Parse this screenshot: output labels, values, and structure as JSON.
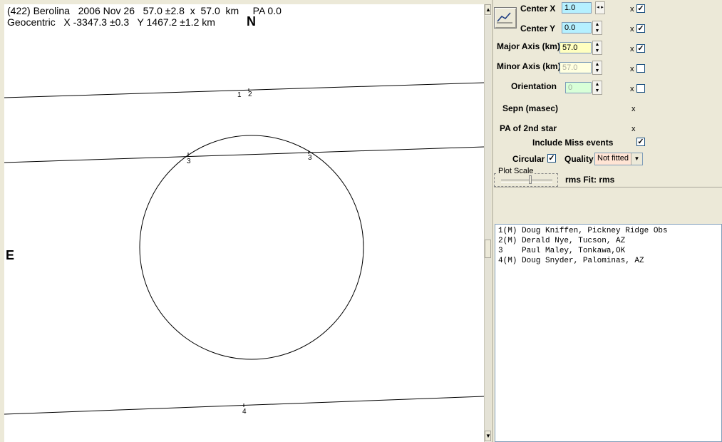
{
  "plot": {
    "header_line1": "(422) Berolina   2006 Nov 26   57.0 ±2.8  x  57.0  km     PA 0.0",
    "header_line2": "Geocentric   X -3347.3 ±0.3   Y 1467.2 ±1.2 km",
    "north_label": "N",
    "east_label": "E",
    "chord_labels": [
      "1",
      "2",
      "3",
      "3",
      "4"
    ]
  },
  "controls": {
    "center_x": {
      "label": "Center X",
      "value": "1.0",
      "x_mark": "x",
      "checked": true,
      "color": "#b5f0ff"
    },
    "center_y": {
      "label": "Center Y",
      "value": "0.0",
      "x_mark": "x",
      "checked": true,
      "color": "#b5f0ff"
    },
    "major_axis": {
      "label": "Major Axis (km)",
      "value": "57.0",
      "x_mark": "x",
      "checked": true,
      "color": "#ffffc0"
    },
    "minor_axis": {
      "label": "Minor Axis (km)",
      "value": "57.0",
      "x_mark": "x",
      "checked": false,
      "color": "#ffffe0"
    },
    "orientation": {
      "label": "Orientation",
      "value": "0",
      "x_mark": "x",
      "checked": false,
      "color": "#d8ffd8"
    },
    "sepn": {
      "label": "Sepn (masec)",
      "x_mark": "x"
    },
    "pa_2nd_star": {
      "label": "PA of 2nd star",
      "x_mark": "x"
    },
    "include_miss": {
      "label": "Include Miss events",
      "checked": true
    },
    "circular": {
      "label": "Circular",
      "checked": true
    },
    "quality": {
      "label": "Quality",
      "selected": "Not fitted"
    },
    "plot_scale": {
      "label": "Plot Scale"
    },
    "rms_fit": "rms Fit: rms",
    "check_mark": "✓"
  },
  "observers": [
    "1(M) Doug Kniffen, Pickney Ridge Obs",
    "2(M) Derald Nye, Tucson, AZ",
    "3    Paul Maley, Tonkawa,OK",
    "4(M) Doug Snyder, Palominas, AZ"
  ]
}
